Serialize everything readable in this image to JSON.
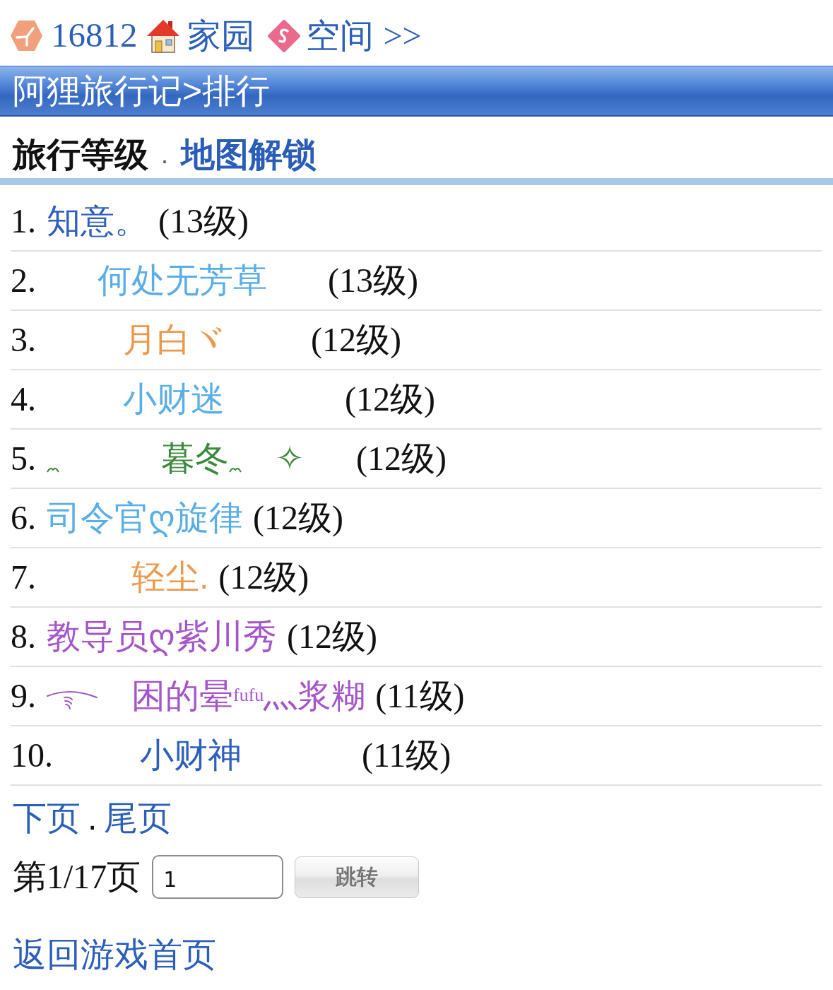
{
  "top_nav": {
    "points": "16812",
    "links": [
      {
        "label": "家园"
      },
      {
        "label": "空间"
      }
    ],
    "more": ">>"
  },
  "title_bar": {
    "title": "阿狸旅行记>排行"
  },
  "tabs": [
    {
      "label": "旅行等级",
      "selected": true
    },
    {
      "label": "地图解锁",
      "selected": false
    }
  ],
  "tab_separator": ".",
  "rows": [
    {
      "rank": "1.",
      "color": "#2e5fbd",
      "parts": [
        {
          "kind": "text",
          "text": "知意。"
        }
      ],
      "grade": "(13级)"
    },
    {
      "rank": "2.",
      "color": "#5aaee6",
      "parts": [
        {
          "kind": "text",
          "text": "　  何处无芳草　  "
        }
      ],
      "grade": "(13级)"
    },
    {
      "rank": "3.",
      "color": "#eb9a4c",
      "parts": [
        {
          "kind": "text",
          "text": "　　 月白ヾ　　 "
        }
      ],
      "grade": "(12级)"
    },
    {
      "rank": "4.",
      "color": "#5aaee6",
      "parts": [
        {
          "kind": "text",
          "text": "　　 小财迷　　　 "
        }
      ],
      "grade": "(12级)"
    },
    {
      "rank": "5.",
      "color": "#3b8a3b",
      "parts": [
        {
          "kind": "wave"
        },
        {
          "kind": "text",
          "text": "　　　暮冬"
        },
        {
          "kind": "wave"
        },
        {
          "kind": "text",
          "text": "　✧　 "
        }
      ],
      "grade": "(12级)"
    },
    {
      "rank": "6.",
      "color": "#5aaee6",
      "parts": [
        {
          "kind": "text",
          "text": "司令官ღ旋律"
        }
      ],
      "grade": "(12级)"
    },
    {
      "rank": "7.",
      "color": "#eb9a4c",
      "parts": [
        {
          "kind": "text",
          "text": "　　  轻尘."
        }
      ],
      "grade": "(12级)"
    },
    {
      "rank": "8.",
      "color": "#a555c9",
      "parts": [
        {
          "kind": "text",
          "text": "教导员ღ紫川秀"
        }
      ],
      "grade": "(12级)"
    },
    {
      "rank": "9.",
      "color": "#a555c9",
      "parts": [
        {
          "kind": "curve"
        },
        {
          "kind": "text",
          "text": "　困的晕$^{fufu}$灬浆糊"
        }
      ],
      "grade": "(11级)"
    },
    {
      "rank": "10.",
      "color": "#2e5fbd",
      "parts": [
        {
          "kind": "text",
          "text": "　　 小财神　　　 "
        }
      ],
      "grade": "(11级)"
    }
  ],
  "pager": {
    "links": [
      {
        "label": "下页"
      },
      {
        "label": "尾页"
      }
    ],
    "separator": ".",
    "page_info": "第1/17页",
    "page_input": {
      "value": "1"
    },
    "go_button": {
      "label": "跳转",
      "disabled": true
    }
  },
  "back_link": "返回游戏首页"
}
